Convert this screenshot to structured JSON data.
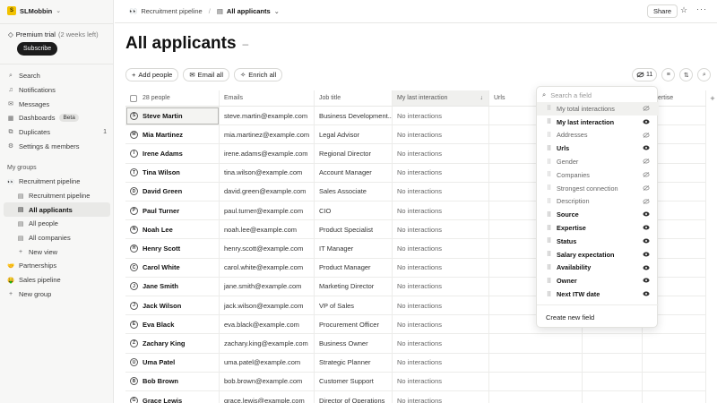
{
  "workspace": {
    "name": "SLMobbin",
    "logo": "S"
  },
  "trial": {
    "label": "Premium trial",
    "remaining": "(2 weeks left)",
    "subscribe": "Subscribe"
  },
  "nav_top": [
    {
      "label": "Search",
      "icon": "search-icon"
    },
    {
      "label": "Notifications",
      "icon": "bell-icon"
    },
    {
      "label": "Messages",
      "icon": "mail-icon"
    },
    {
      "label": "Dashboards",
      "icon": "chart-icon",
      "badge": "Beta"
    },
    {
      "label": "Duplicates",
      "icon": "duplicate-icon",
      "count": "1"
    },
    {
      "label": "Settings & members",
      "icon": "gear-icon"
    }
  ],
  "groups_label": "My groups",
  "groups": [
    {
      "label": "Recruitment pipeline",
      "emoji": "👀"
    },
    {
      "label": "Recruitment pipeline",
      "sub": true
    },
    {
      "label": "All applicants",
      "sub": true,
      "active": true
    },
    {
      "label": "All people",
      "sub": true
    },
    {
      "label": "All companies",
      "sub": true
    },
    {
      "label": "New view",
      "sub": true,
      "add": true
    },
    {
      "label": "Partnerships",
      "emoji": "🤝"
    },
    {
      "label": "Sales pipeline",
      "emoji": "🤑"
    },
    {
      "label": "New group",
      "add": true
    }
  ],
  "breadcrumb": {
    "group": "Recruitment pipeline",
    "view": "All applicants",
    "emoji": "👀"
  },
  "topbar": {
    "share": "Share"
  },
  "page": {
    "title": "All applicants"
  },
  "toolbar": {
    "add_people": "Add people",
    "email_all": "Email all",
    "enrich_all": "Enrich all",
    "hidden_count": "11"
  },
  "table": {
    "columns": [
      "28 people",
      "Emails",
      "Job title",
      "My last interaction",
      "Urls",
      "",
      "Expertise"
    ],
    "rows": [
      {
        "initial": "S",
        "name": "Steve Martin",
        "email": "steve.martin@example.com",
        "job": "Business Development...",
        "interaction": "No interactions"
      },
      {
        "initial": "M",
        "name": "Mia Martinez",
        "email": "mia.martinez@example.com",
        "job": "Legal Advisor",
        "interaction": "No interactions"
      },
      {
        "initial": "I",
        "name": "Irene Adams",
        "email": "irene.adams@example.com",
        "job": "Regional Director",
        "interaction": "No interactions"
      },
      {
        "initial": "T",
        "name": "Tina Wilson",
        "email": "tina.wilson@example.com",
        "job": "Account Manager",
        "interaction": "No interactions"
      },
      {
        "initial": "D",
        "name": "David Green",
        "email": "david.green@example.com",
        "job": "Sales Associate",
        "interaction": "No interactions"
      },
      {
        "initial": "P",
        "name": "Paul Turner",
        "email": "paul.turner@example.com",
        "job": "CIO",
        "interaction": "No interactions"
      },
      {
        "initial": "N",
        "name": "Noah Lee",
        "email": "noah.lee@example.com",
        "job": "Product Specialist",
        "interaction": "No interactions"
      },
      {
        "initial": "H",
        "name": "Henry Scott",
        "email": "henry.scott@example.com",
        "job": "IT Manager",
        "interaction": "No interactions"
      },
      {
        "initial": "C",
        "name": "Carol White",
        "email": "carol.white@example.com",
        "job": "Product Manager",
        "interaction": "No interactions"
      },
      {
        "initial": "J",
        "name": "Jane Smith",
        "email": "jane.smith@example.com",
        "job": "Marketing Director",
        "interaction": "No interactions"
      },
      {
        "initial": "J",
        "name": "Jack Wilson",
        "email": "jack.wilson@example.com",
        "job": "VP of Sales",
        "interaction": "No interactions"
      },
      {
        "initial": "E",
        "name": "Eva Black",
        "email": "eva.black@example.com",
        "job": "Procurement Officer",
        "interaction": "No interactions"
      },
      {
        "initial": "Z",
        "name": "Zachary King",
        "email": "zachary.king@example.com",
        "job": "Business Owner",
        "interaction": "No interactions"
      },
      {
        "initial": "U",
        "name": "Uma Patel",
        "email": "uma.patel@example.com",
        "job": "Strategic Planner",
        "interaction": "No interactions"
      },
      {
        "initial": "B",
        "name": "Bob Brown",
        "email": "bob.brown@example.com",
        "job": "Customer Support",
        "interaction": "No interactions"
      },
      {
        "initial": "G",
        "name": "Grace Lewis",
        "email": "grace.lewis@example.com",
        "job": "Director of Operations",
        "interaction": "No interactions"
      }
    ]
  },
  "field_menu": {
    "search_placeholder": "Search a field",
    "fields": [
      {
        "label": "My total interactions",
        "visible": false
      },
      {
        "label": "My last interaction",
        "visible": true
      },
      {
        "label": "Addresses",
        "visible": false
      },
      {
        "label": "Urls",
        "visible": true
      },
      {
        "label": "Gender",
        "visible": false
      },
      {
        "label": "Companies",
        "visible": false
      },
      {
        "label": "Strongest connection",
        "visible": false
      },
      {
        "label": "Description",
        "visible": false
      },
      {
        "label": "Source",
        "visible": true
      },
      {
        "label": "Expertise",
        "visible": true
      },
      {
        "label": "Status",
        "visible": true
      },
      {
        "label": "Salary expectation",
        "visible": true
      },
      {
        "label": "Availability",
        "visible": true
      },
      {
        "label": "Owner",
        "visible": true
      },
      {
        "label": "Next ITW date",
        "visible": true
      }
    ],
    "create": "Create new field"
  },
  "colors": {
    "accent_dark": "#1c1c1c",
    "logo": "#f2c200"
  }
}
